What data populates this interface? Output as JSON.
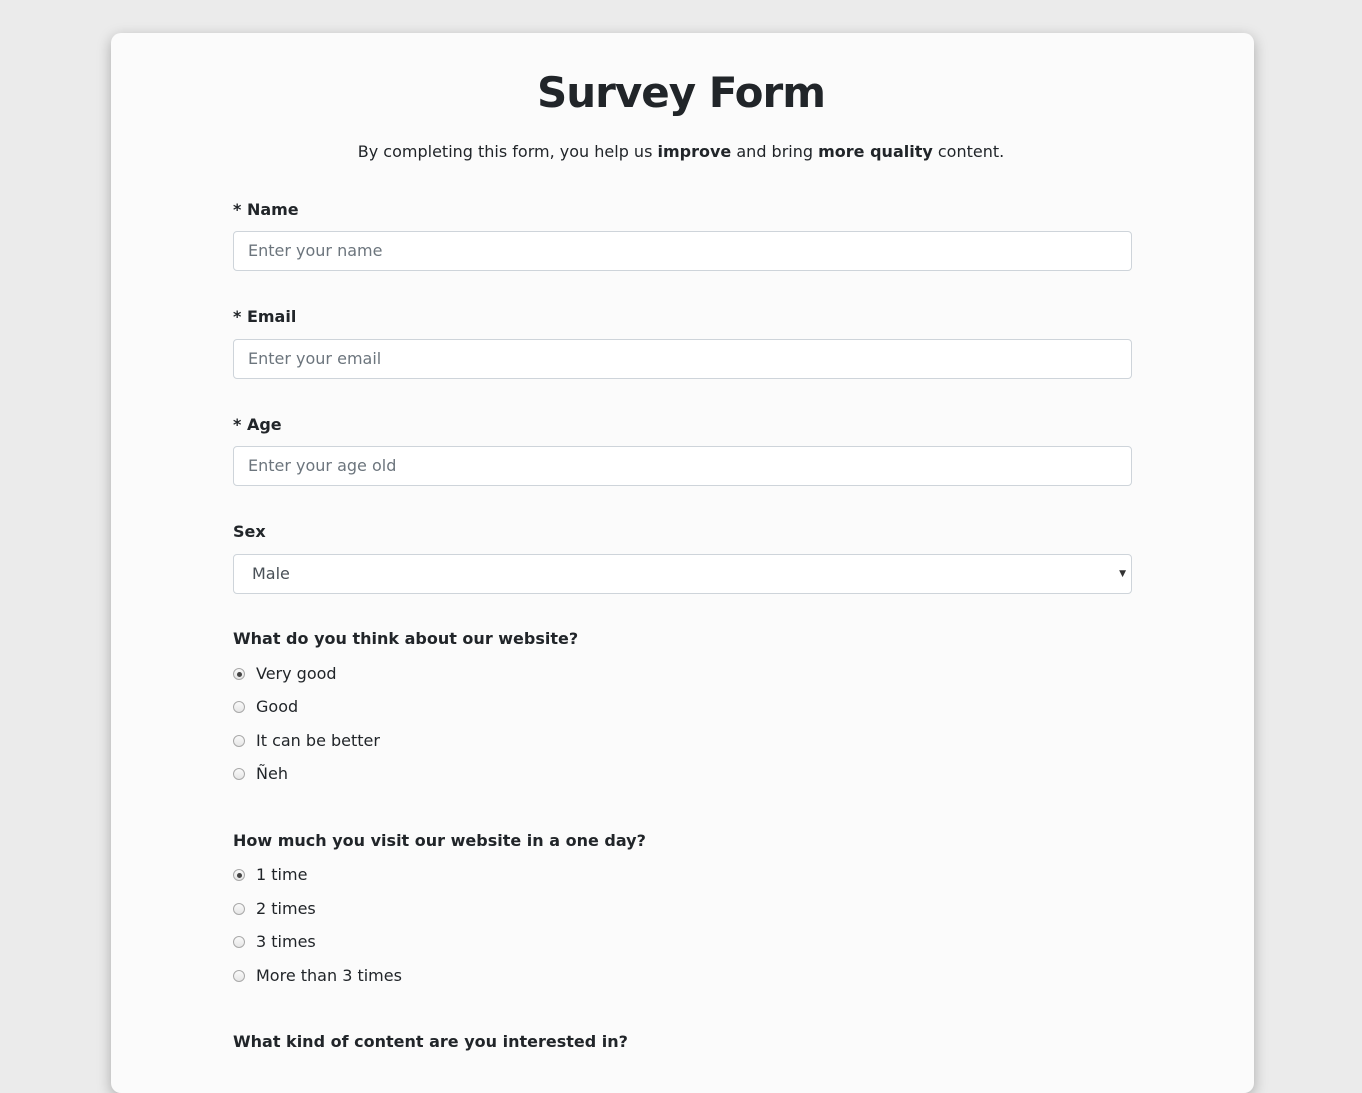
{
  "header": {
    "title": "Survey Form",
    "subtitle_pre": "By completing this form, you help us ",
    "subtitle_bold1": "improve",
    "subtitle_mid": " and bring ",
    "subtitle_bold2": "more quality",
    "subtitle_post": " content."
  },
  "fields": {
    "name": {
      "label": "* Name",
      "placeholder": "Enter your name"
    },
    "email": {
      "label": "* Email",
      "placeholder": "Enter your email"
    },
    "age": {
      "label": "* Age",
      "placeholder": "Enter your age old"
    },
    "sex": {
      "label": "Sex",
      "selected": "Male"
    }
  },
  "questions": {
    "opinion": {
      "label": "What do you think about our website?",
      "options": [
        "Very good",
        "Good",
        "It can be better",
        "Ñeh"
      ],
      "selected_index": 0
    },
    "visits": {
      "label": "How much you visit our website in a one day?",
      "options": [
        "1 time",
        "2 times",
        "3 times",
        "More than 3 times"
      ],
      "selected_index": 0
    },
    "content": {
      "label": "What kind of content are you interested in?"
    }
  },
  "icons": {
    "select_caret": "chevron-down-icon"
  }
}
